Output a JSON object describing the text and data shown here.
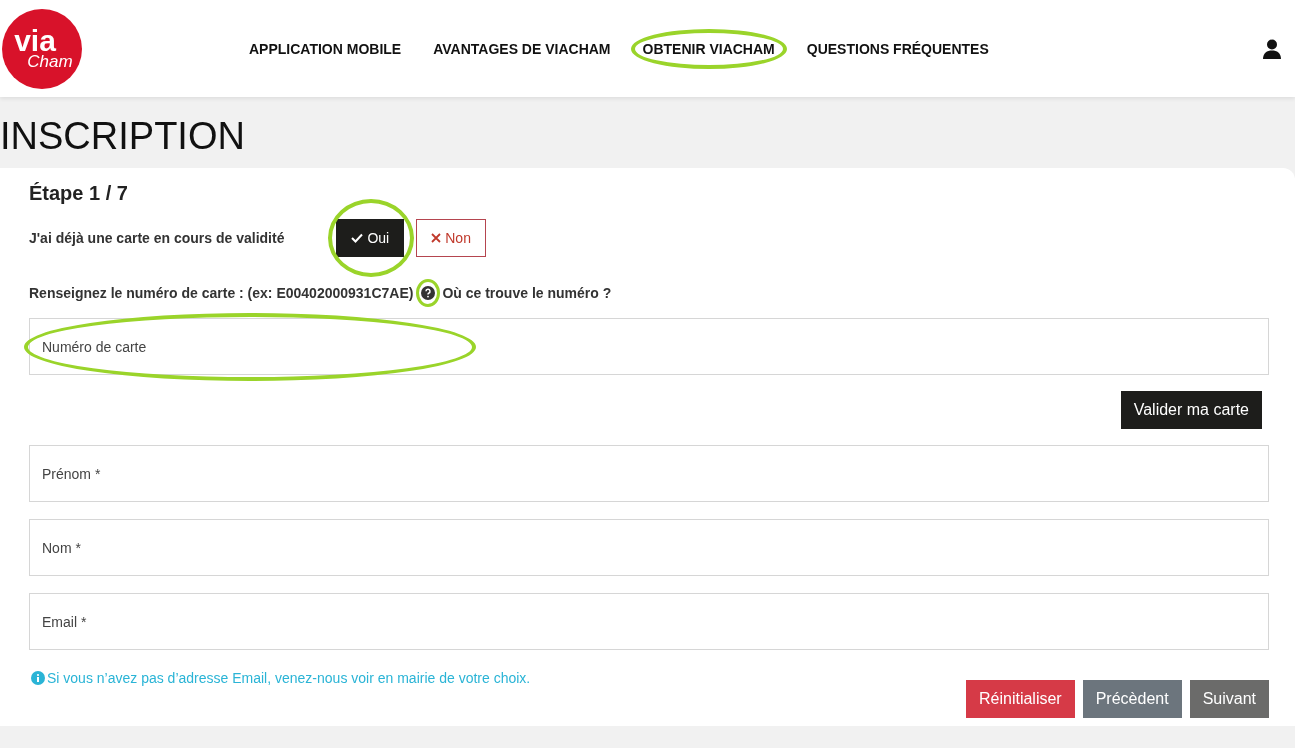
{
  "logo": {
    "line_1": "via",
    "line_2": "Cham"
  },
  "nav": [
    {
      "label": "APPLICATION MOBILE",
      "highlighted": false
    },
    {
      "label": "AVANTAGES DE VIACHAM",
      "highlighted": false
    },
    {
      "label": "OBTENIR VIACHAM",
      "highlighted": true
    },
    {
      "label": "QUESTIONS FRÉQUENTES",
      "highlighted": false
    }
  ],
  "page_title": "INSCRIPTION",
  "step": "Étape 1 / 7",
  "card_question": {
    "label": "J'ai déjà une carte en cours de validité",
    "options": [
      {
        "kind": "yes",
        "label": "Oui",
        "selected": true,
        "highlighted": true
      },
      {
        "kind": "no",
        "label": "Non",
        "selected": false,
        "highlighted": false
      }
    ]
  },
  "card_number_hint": {
    "label": "Renseignez le numéro de carte : (ex: E00402000931C7AE)",
    "help_highlighted": true,
    "help_link": "Où ce trouve le numéro ?"
  },
  "card_number_field": {
    "placeholder": "Numéro de carte",
    "highlighted": true
  },
  "validate_button": "Valider ma carte",
  "fields": [
    {
      "placeholder": "Prénom *"
    },
    {
      "placeholder": "Nom *"
    },
    {
      "placeholder": "Email *"
    }
  ],
  "info": "Si vous n’avez pas d’adresse Email, venez-nous voir en mairie de votre choix.",
  "actions": [
    {
      "kind": "reset",
      "label": "Réinitialiser"
    },
    {
      "kind": "previous",
      "label": "Précèdent"
    },
    {
      "kind": "next",
      "label": "Suivant"
    }
  ]
}
